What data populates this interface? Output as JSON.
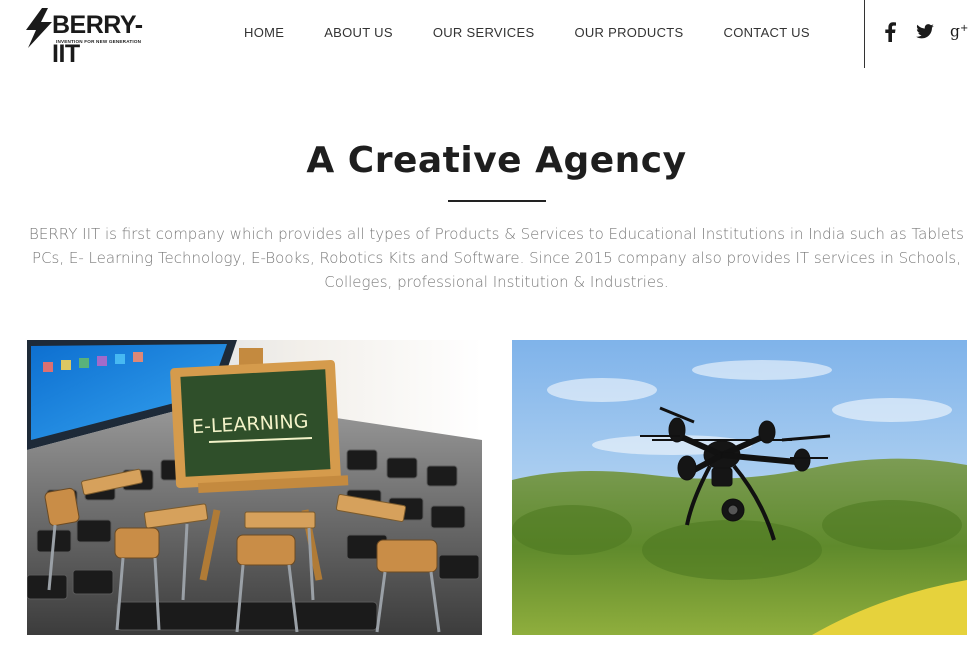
{
  "brand": {
    "name": "BERRY-IIT",
    "tagline": "INVENTION FOR NEW GENERATION"
  },
  "nav": {
    "items": [
      {
        "label": "HOME"
      },
      {
        "label": "ABOUT US"
      },
      {
        "label": "OUR SERVICES"
      },
      {
        "label": "OUR PRODUCTS"
      },
      {
        "label": "CONTACT US"
      }
    ]
  },
  "social": {
    "icons": [
      "facebook-icon",
      "twitter-icon",
      "google-plus-icon"
    ]
  },
  "hero": {
    "title": "A Creative Agency",
    "description": "BERRY IIT is first company which provides all types of Products & Services to Educational Institutions in India such as Tablets PCs, E- Learning Technology, E-Books, Robotics Kits and Software. Since 2015 company also provides IT services in Schools, Colleges, professional Institution & Industries."
  },
  "gallery": {
    "elearning_board_text": "E-LEARNING"
  },
  "colors": {
    "text_dark": "#1e1e1e",
    "text_muted": "#7a7a7a",
    "sky": "#8fc0ee",
    "foliage": "#6f9a35",
    "chalkboard": "#2f4f2a"
  }
}
